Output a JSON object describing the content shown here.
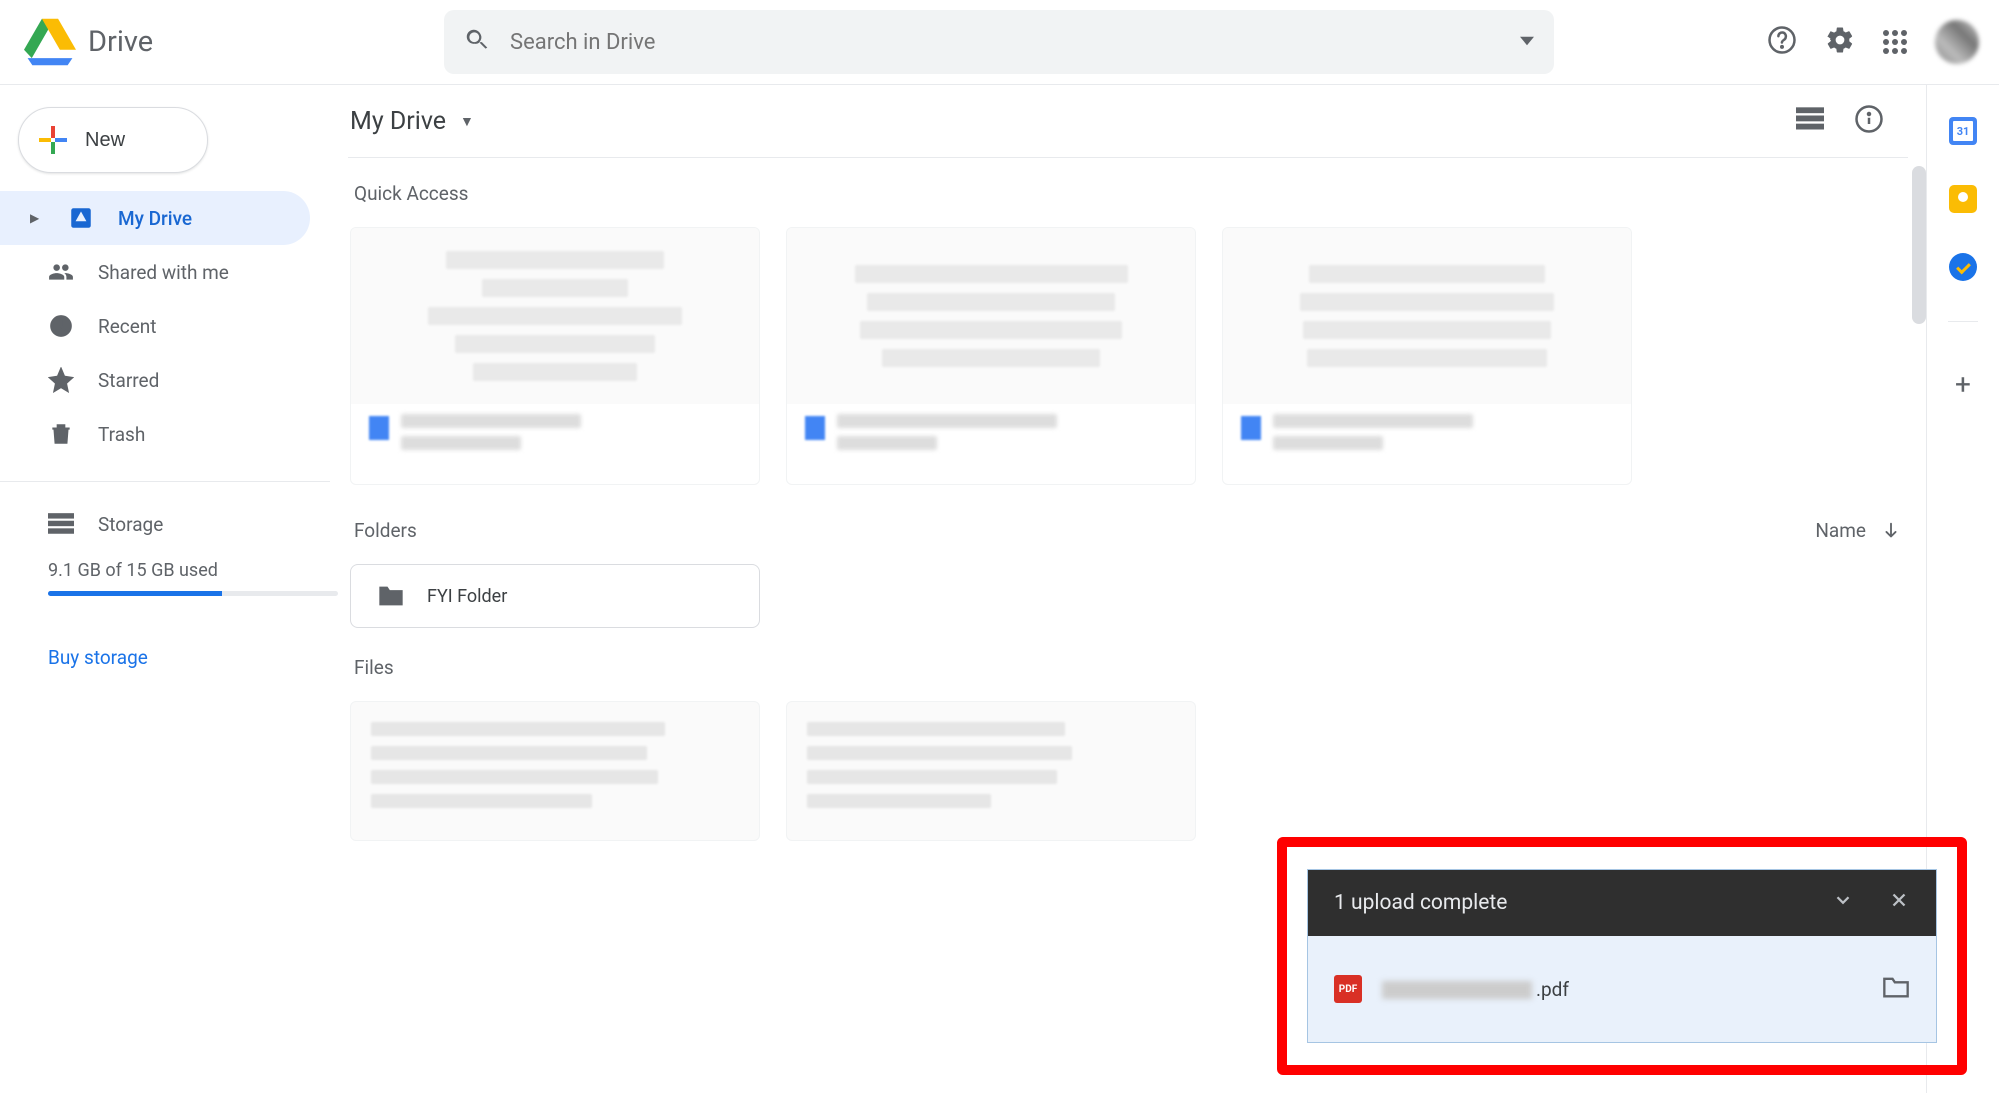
{
  "app": {
    "name": "Drive",
    "search_placeholder": "Search in Drive"
  },
  "sidebar": {
    "new_label": "New",
    "items": [
      {
        "label": "My Drive"
      },
      {
        "label": "Shared with me"
      },
      {
        "label": "Recent"
      },
      {
        "label": "Starred"
      },
      {
        "label": "Trash"
      }
    ],
    "storage": {
      "label": "Storage",
      "usage_text": "9.1 GB of 15 GB used",
      "buy_label": "Buy storage",
      "used_gb": 9.1,
      "total_gb": 15
    }
  },
  "main": {
    "breadcrumb": "My Drive",
    "sections": {
      "quick_access": "Quick Access",
      "folders": "Folders",
      "files": "Files"
    },
    "sort": {
      "label": "Name",
      "direction": "descending"
    },
    "folders": [
      {
        "name": "FYI Folder"
      }
    ]
  },
  "upload_toast": {
    "title": "1 upload complete",
    "file_ext": ".pdf"
  },
  "sidepanel_apps": [
    "calendar",
    "keep",
    "tasks"
  ]
}
